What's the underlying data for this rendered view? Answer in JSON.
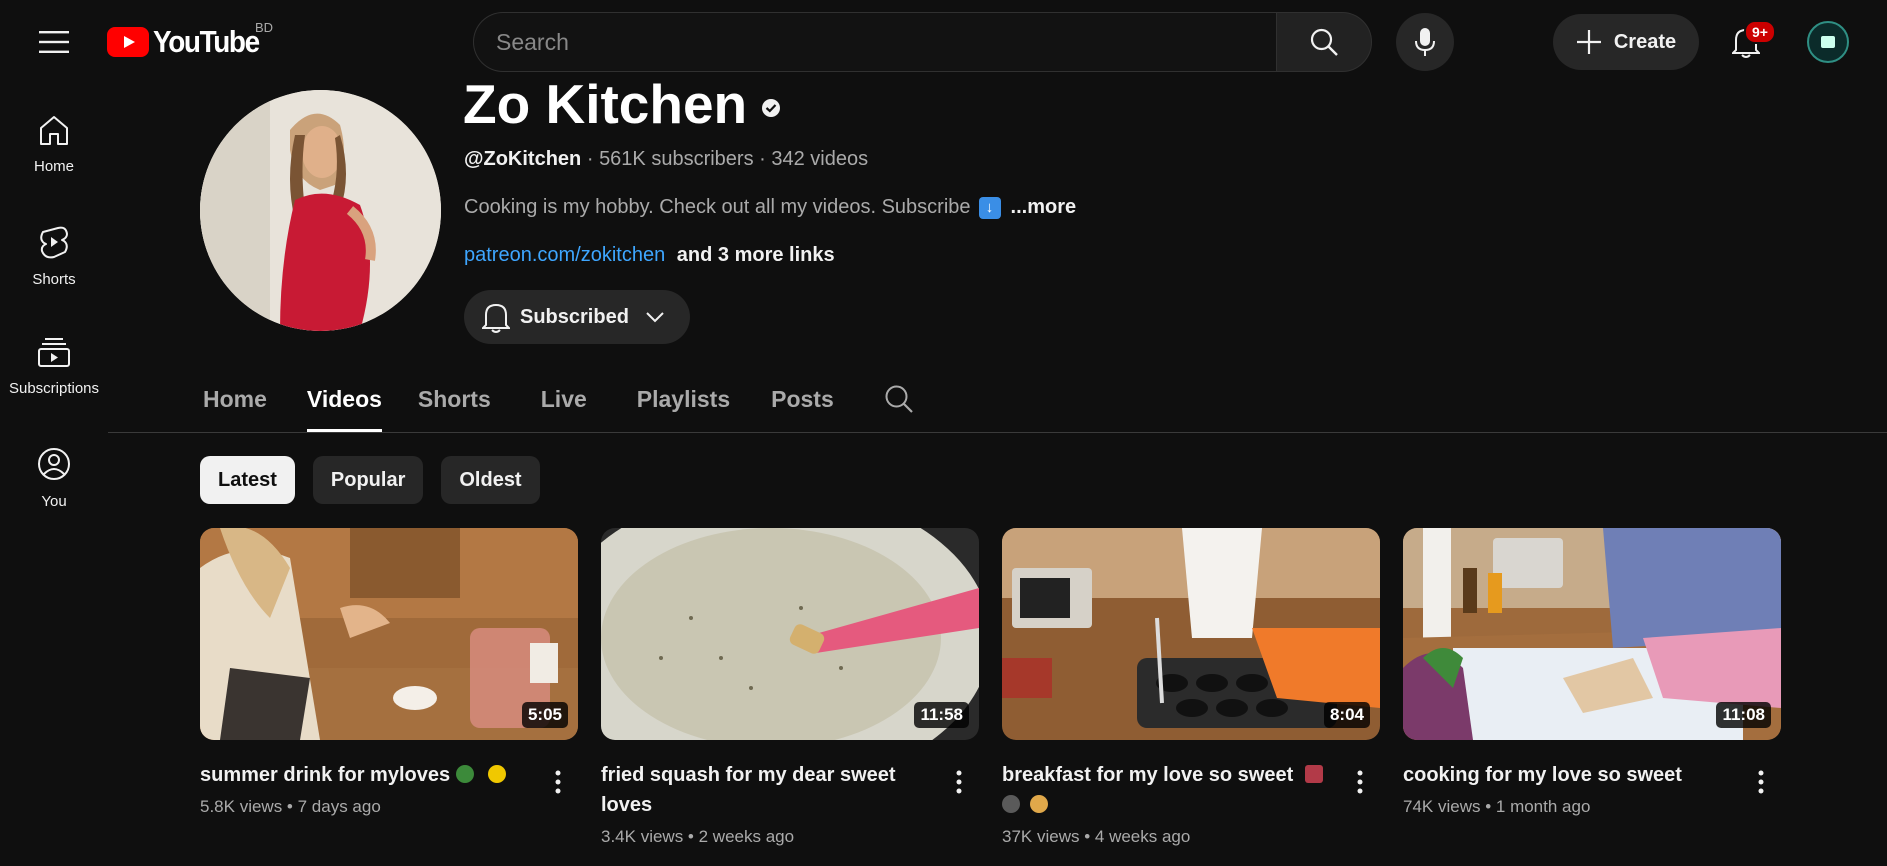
{
  "header": {
    "logo_text": "YouTube",
    "country_code": "BD",
    "search_placeholder": "Search",
    "create_label": "Create",
    "notification_count": "9+"
  },
  "sidenav": {
    "items": [
      {
        "label": "Home",
        "icon": "home-icon"
      },
      {
        "label": "Shorts",
        "icon": "shorts-icon"
      },
      {
        "label": "Subscriptions",
        "icon": "subscriptions-icon"
      },
      {
        "label": "You",
        "icon": "you-icon"
      }
    ]
  },
  "channel": {
    "name": "Zo Kitchen",
    "handle": "@ZoKitchen",
    "subscribers": "561K subscribers",
    "videos": "342 videos",
    "description": "Cooking is my hobby. Check out all my videos. Subscribe",
    "more_label": "...more",
    "link": "patreon.com/zokitchen",
    "more_links": "and 3 more links",
    "subscribe_label": "Subscribed"
  },
  "tabs": [
    "Home",
    "Videos",
    "Shorts",
    "Live",
    "Playlists",
    "Posts"
  ],
  "active_tab": "Videos",
  "chips": [
    "Latest",
    "Popular",
    "Oldest"
  ],
  "active_chip": "Latest",
  "videos": [
    {
      "title": "summer drink for myloves",
      "views": "5.8K views",
      "age": "7 days ago",
      "duration": "5:05"
    },
    {
      "title": "fried squash for my dear sweet loves",
      "views": "3.4K views",
      "age": "2 weeks ago",
      "duration": "11:58"
    },
    {
      "title": "breakfast for my love so sweet",
      "views": "37K views",
      "age": "4 weeks ago",
      "duration": "8:04"
    },
    {
      "title": "cooking for my love so sweet",
      "views": "74K views",
      "age": "1 month ago",
      "duration": "11:08"
    }
  ],
  "colors": {
    "background": "#0f0f0f",
    "youtube_red": "#ff0000",
    "link_blue": "#3ea6ff",
    "badge_red": "#cc0000"
  }
}
